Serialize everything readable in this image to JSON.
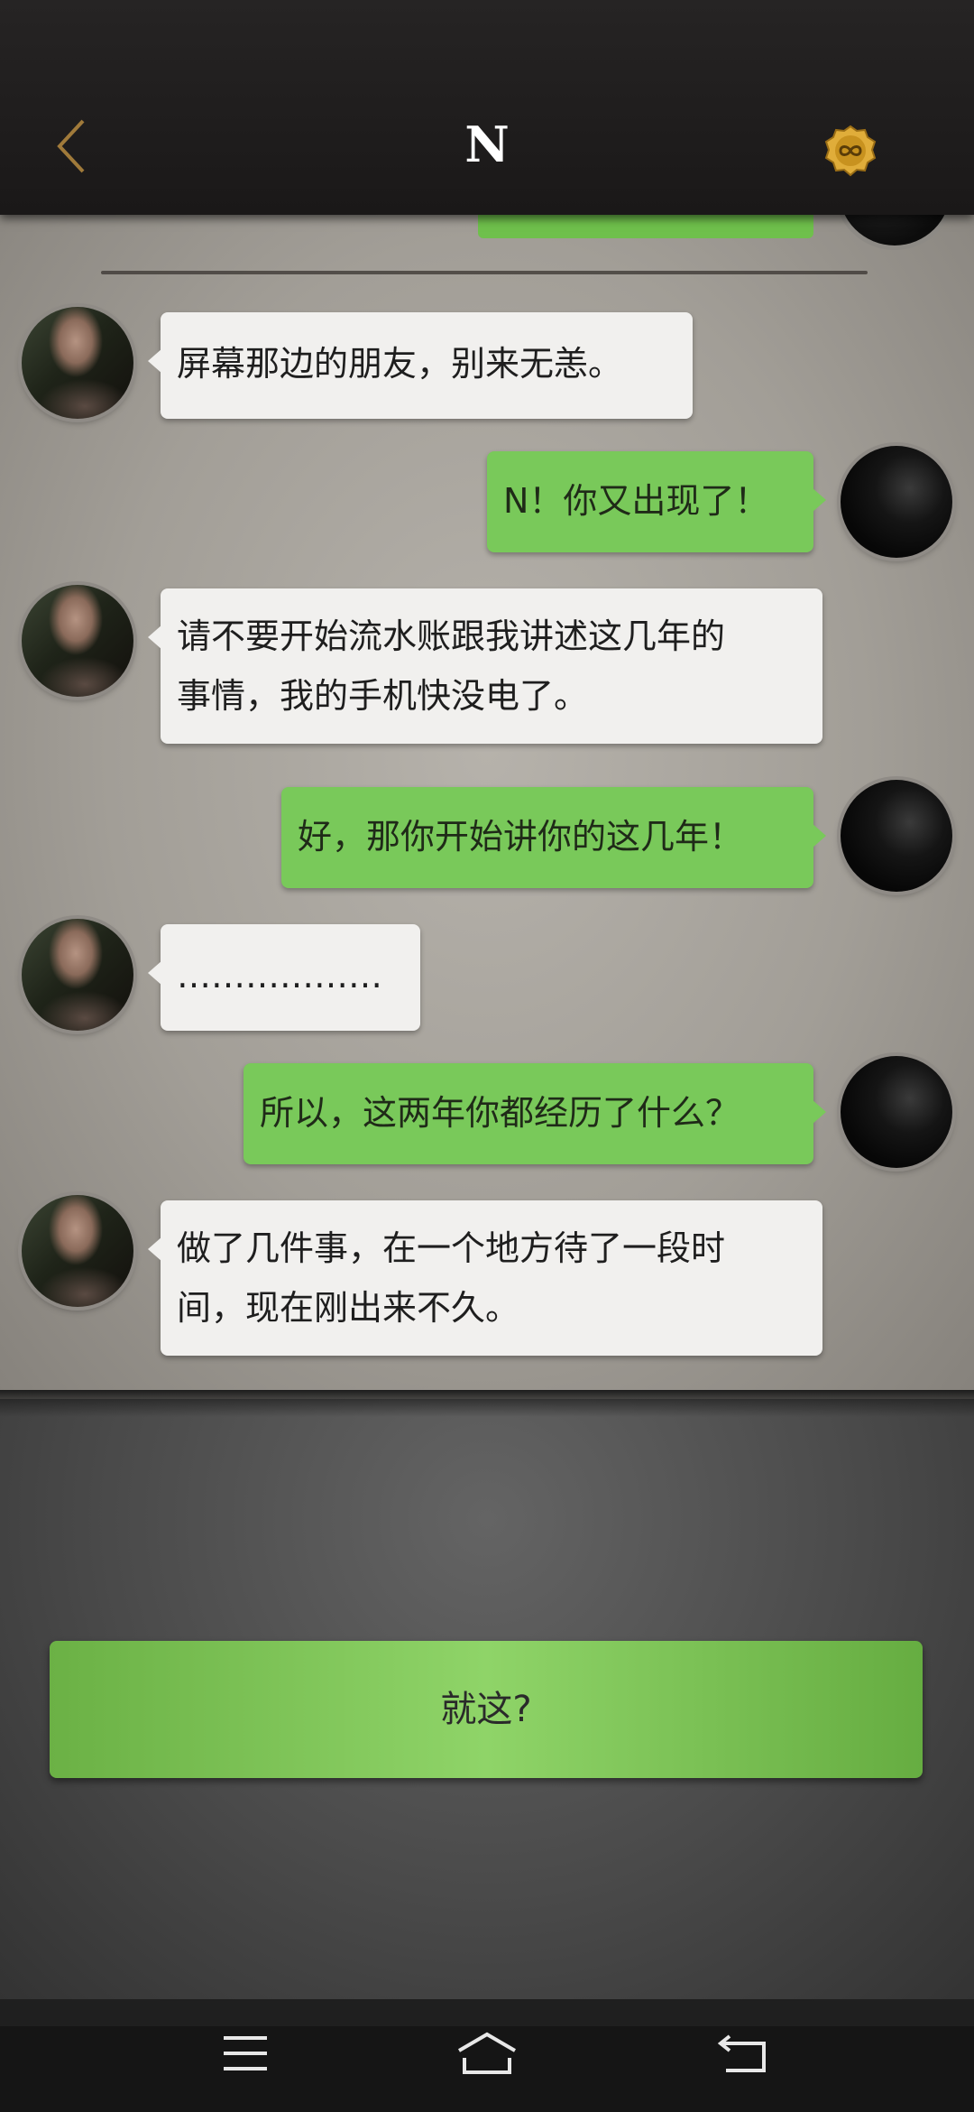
{
  "header": {
    "title": "N",
    "back_icon": "chevron-left-icon",
    "coin_icon": "infinity-coin-icon"
  },
  "messages": [
    {
      "side": "left",
      "text": "屏幕那边的朋友，别来无恙。"
    },
    {
      "side": "right",
      "text": "N！你又出现了！"
    },
    {
      "side": "left",
      "lines": [
        "请不要开始流水账跟我讲述这几年的",
        "事情，我的手机快没电了。"
      ]
    },
    {
      "side": "right",
      "text": "好，那你开始讲你的这几年！"
    },
    {
      "side": "left",
      "text": "………………"
    },
    {
      "side": "right",
      "text": "所以，这两年你都经历了什么？"
    },
    {
      "side": "left",
      "lines": [
        "做了几件事，在一个地方待了一段时",
        "间，现在刚出来不久。"
      ]
    }
  ],
  "choice": {
    "label": "就这?"
  },
  "navbar": {
    "icons": [
      "menu-icon",
      "home-icon",
      "back-icon"
    ]
  },
  "colors": {
    "accent_green": "#79c95a",
    "back_gold": "#a07a3a",
    "coin_gold": "#d9a632"
  }
}
